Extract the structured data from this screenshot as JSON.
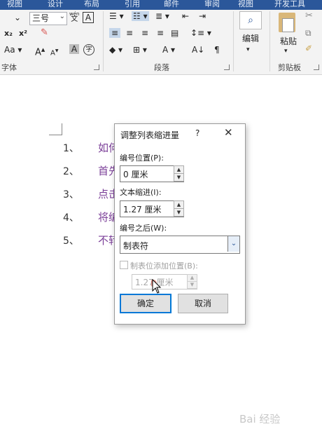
{
  "ribbon_tabs": [
    "视图",
    "设计",
    "布局",
    "引用",
    "邮件",
    "审阅",
    "视图",
    "开发工具"
  ],
  "font": {
    "size_value": "三号",
    "group_label": "字体",
    "phonetic_icon_text": "wén",
    "phonetic_char": "文",
    "border_char": "A",
    "subscript": "x₂",
    "superscript": "x²",
    "change_case": "Aa",
    "grow": "A",
    "shrink": "A",
    "char_shading": "A",
    "enclose_char": "字"
  },
  "paragraph": {
    "group_label": "段落"
  },
  "editing": {
    "label": "编辑"
  },
  "clipboard": {
    "paste_label": "粘贴",
    "group_label": "剪贴板"
  },
  "document": {
    "list_items": [
      {
        "num": "1、",
        "text": "如何"
      },
      {
        "num": "2、",
        "text": "首先"
      },
      {
        "num": "3、",
        "text": "点击"
      },
      {
        "num": "4、",
        "text": "将编"
      },
      {
        "num": "5、",
        "text": "不转"
      }
    ]
  },
  "dialog": {
    "title": "调整列表缩进量",
    "help": "?",
    "close": "✕",
    "number_position_label": "编号位置(P):",
    "number_position_value": "0 厘米",
    "text_indent_label": "文本缩进(I):",
    "text_indent_value": "1.27 厘米",
    "follow_number_label": "编号之后(W):",
    "follow_number_value": "制表符",
    "add_tab_stop_label": "制表位添加位置(B):",
    "add_tab_stop_checked": false,
    "tab_stop_value": "1.27 厘米",
    "ok_label": "确定",
    "cancel_label": "取消"
  },
  "watermark": "Bai 经验",
  "colors": {
    "ribbon_blue": "#2b579a",
    "list_text": "#7b3f98",
    "focus": "#0078d7"
  }
}
